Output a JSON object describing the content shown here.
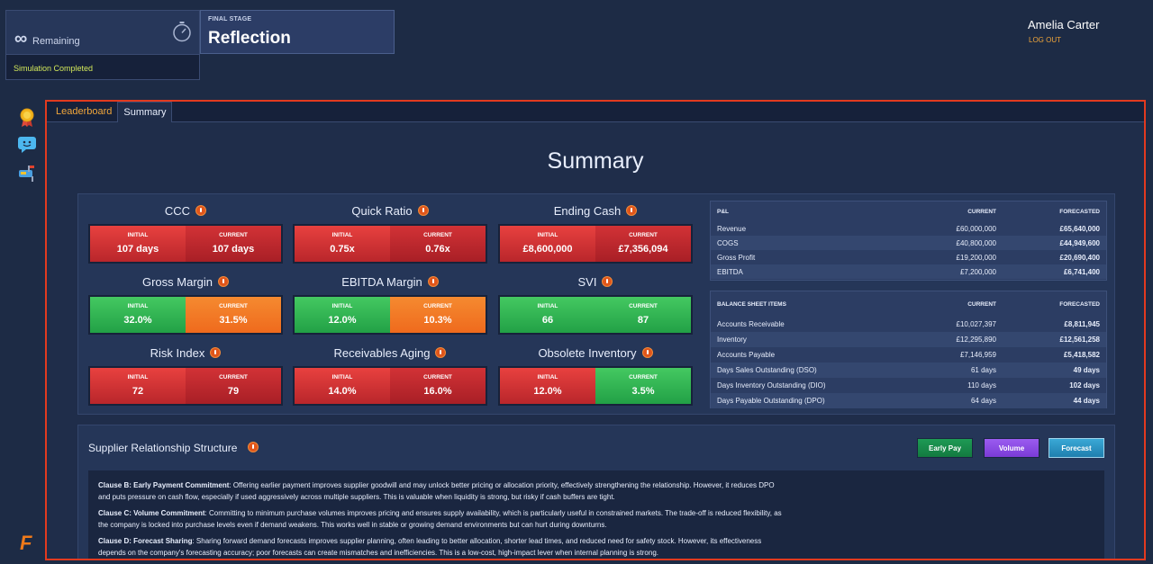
{
  "status": {
    "remaining_label": "Remaining",
    "remaining_value": "∞",
    "completion_text": "Simulation Completed"
  },
  "stage": {
    "label": "FINAL STAGE",
    "name": "Reflection"
  },
  "user": {
    "name": "Amelia Carter",
    "logout_label": "LOG OUT"
  },
  "rail": [
    "award-icon",
    "chat-icon",
    "mailbox-icon"
  ],
  "brand": "F",
  "tabs": [
    {
      "label": "Leaderboard",
      "active": false
    },
    {
      "label": "Summary",
      "active": true
    }
  ],
  "page_title": "Summary",
  "kpi_labels": {
    "initial": "INITIAL",
    "current": "CURRENT"
  },
  "kpis": [
    {
      "name": "CCC",
      "initial": "107 days",
      "current": "107 days",
      "initial_color": "red",
      "current_color": "red"
    },
    {
      "name": "Quick Ratio",
      "initial": "0.75x",
      "current": "0.76x",
      "initial_color": "red",
      "current_color": "red"
    },
    {
      "name": "Ending Cash",
      "initial": "£8,600,000",
      "current": "£7,356,094",
      "initial_color": "red",
      "current_color": "red"
    },
    {
      "name": "Gross Margin",
      "initial": "32.0%",
      "current": "31.5%",
      "initial_color": "green",
      "current_color": "orange"
    },
    {
      "name": "EBITDA Margin",
      "initial": "12.0%",
      "current": "10.3%",
      "initial_color": "green",
      "current_color": "orange"
    },
    {
      "name": "SVI",
      "initial": "66",
      "current": "87",
      "initial_color": "green",
      "current_color": "green"
    },
    {
      "name": "Risk Index",
      "initial": "72",
      "current": "79",
      "initial_color": "red",
      "current_color": "red"
    },
    {
      "name": "Receivables Aging",
      "initial": "14.0%",
      "current": "16.0%",
      "initial_color": "red",
      "current_color": "red"
    },
    {
      "name": "Obsolete Inventory",
      "initial": "12.0%",
      "current": "3.5%",
      "initial_color": "red",
      "current_color": "green"
    }
  ],
  "pl_table": {
    "headers": [
      "P&L",
      "CURRENT",
      "FORECASTED"
    ],
    "rows": [
      [
        "Revenue",
        "£60,000,000",
        "£65,640,000"
      ],
      [
        "COGS",
        "£40,800,000",
        "£44,949,600"
      ],
      [
        "Gross Profit",
        "£19,200,000",
        "£20,690,400"
      ],
      [
        "EBITDA",
        "£7,200,000",
        "£6,741,400"
      ]
    ]
  },
  "bs_table": {
    "headers": [
      "BALANCE SHEET ITEMS",
      "CURRENT",
      "FORECASTED"
    ],
    "rows": [
      [
        "Accounts Receivable",
        "£10,027,397",
        "£8,811,945"
      ],
      [
        "Inventory",
        "£12,295,890",
        "£12,561,258"
      ],
      [
        "Accounts Payable",
        "£7,146,959",
        "£5,418,582"
      ],
      [
        "Days Sales Outstanding (DSO)",
        "61 days",
        "49 days"
      ],
      [
        "Days Inventory Outstanding (DIO)",
        "110 days",
        "102 days"
      ],
      [
        "Days Payable Outstanding (DPO)",
        "64 days",
        "44 days"
      ]
    ]
  },
  "supplier": {
    "title": "Supplier Relationship Structure",
    "buttons": {
      "early": "Early Pay",
      "volume": "Volume",
      "forecast": "Forecast"
    },
    "clauses": [
      {
        "title": "Clause B: Early Payment Commitment",
        "text": ": Offering earlier payment improves supplier goodwill and may unlock better pricing or allocation priority, effectively strengthening the relationship. However, it reduces DPO and puts pressure on cash flow, especially if used aggressively across multiple suppliers. This is valuable when liquidity is strong, but risky if cash buffers are tight."
      },
      {
        "title": "Clause C: Volume Commitment",
        "text": ": Committing to minimum purchase volumes improves pricing and ensures supply availability, which is particularly useful in constrained markets. The trade-off is reduced flexibility, as the company is locked into purchase levels even if demand weakens. This works well in stable or growing demand environments but can hurt during downturns."
      },
      {
        "title": "Clause D: Forecast Sharing",
        "text": ": Sharing forward demand forecasts improves supplier planning, often leading to better allocation, shorter lead times, and reduced need for safety stock. However, its effectiveness depends on the company's forecasting accuracy; poor forecasts can create mismatches and inefficiencies. This is a low-cost, high-impact lever when internal planning is strong."
      }
    ]
  }
}
